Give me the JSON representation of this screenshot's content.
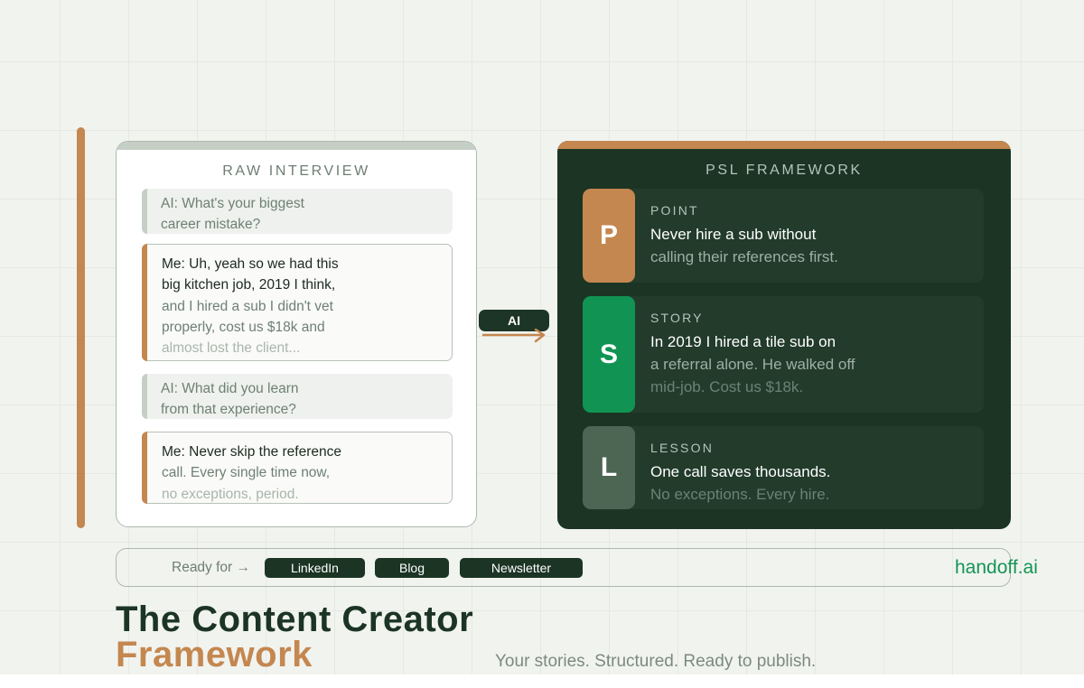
{
  "raw_interview": {
    "heading": "RAW INTERVIEW",
    "messages": [
      {
        "speaker": "ai",
        "lines": [
          "AI: What's your biggest",
          "career mistake?"
        ]
      },
      {
        "speaker": "me",
        "lines": [
          "Me: Uh, yeah so we had this",
          "big kitchen job, 2019 I think,",
          "and I hired a sub I didn't vet",
          "properly, cost us $18k and",
          "almost lost the client..."
        ]
      },
      {
        "speaker": "ai",
        "lines": [
          "AI: What did you learn",
          "from that experience?"
        ]
      },
      {
        "speaker": "me",
        "lines": [
          "Me: Never skip the reference",
          "call. Every single time now,",
          "no exceptions, period."
        ]
      }
    ]
  },
  "connector": {
    "label": "AI",
    "icon": "arrow-right-icon"
  },
  "psl_framework": {
    "heading": "PSL FRAMEWORK",
    "cards": [
      {
        "letter": "P",
        "label": "POINT",
        "color": "#c4874f",
        "lines": [
          "Never hire a sub without",
          "calling their references first."
        ]
      },
      {
        "letter": "S",
        "label": "STORY",
        "color": "#119453",
        "lines": [
          "In 2019 I hired a tile sub on",
          "a referral alone. He walked off",
          "mid-job. Cost us $18k."
        ]
      },
      {
        "letter": "L",
        "label": "LESSON",
        "color": "#4d6553",
        "lines": [
          "One call saves thousands.",
          "No exceptions. Every hire."
        ]
      }
    ]
  },
  "ready_bar": {
    "label": "Ready for →",
    "channels": [
      "LinkedIn",
      "Blog",
      "Newsletter"
    ],
    "brand": "handoff.ai"
  },
  "title": {
    "line1": "The Content Creator",
    "line2": "Framework",
    "tagline": "Your stories. Structured. Ready to publish."
  },
  "colors": {
    "accent_orange": "#c4874f",
    "dark_green": "#1b3424",
    "brand_green": "#149455",
    "background": "#f1f3ef"
  }
}
